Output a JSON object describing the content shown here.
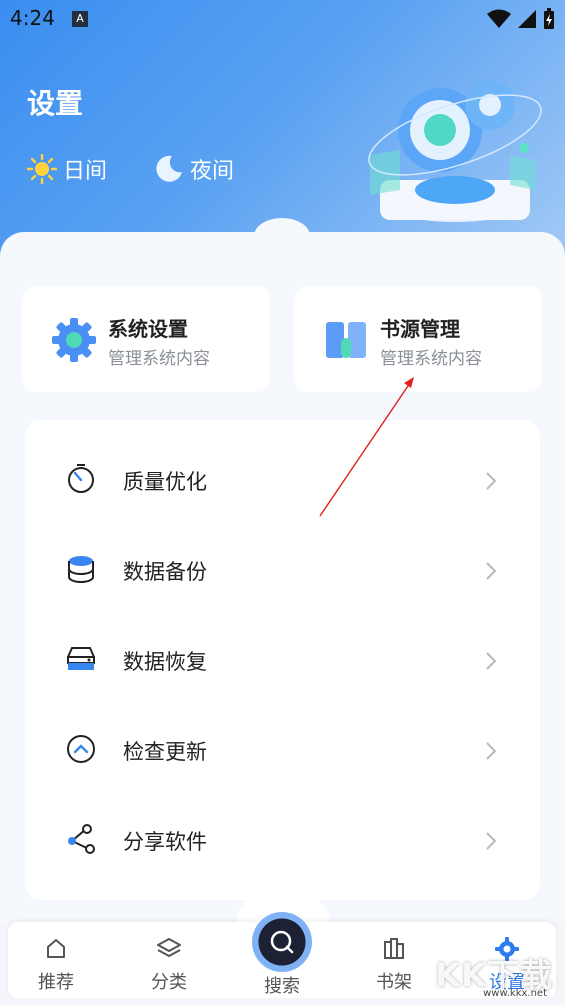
{
  "status_bar": {
    "time": "4:24",
    "app_badge": "A"
  },
  "header": {
    "title": "设置",
    "day_label": "日间",
    "night_label": "夜间"
  },
  "cards": [
    {
      "title": "系统设置",
      "subtitle": "管理系统内容"
    },
    {
      "title": "书源管理",
      "subtitle": "管理系统内容"
    }
  ],
  "list": [
    {
      "label": "质量优化",
      "icon": "timer-icon"
    },
    {
      "label": "数据备份",
      "icon": "database-icon"
    },
    {
      "label": "数据恢复",
      "icon": "server-icon"
    },
    {
      "label": "检查更新",
      "icon": "update-icon"
    },
    {
      "label": "分享软件",
      "icon": "share-icon"
    }
  ],
  "bottom_nav": [
    {
      "label": "推荐",
      "icon": "home-icon"
    },
    {
      "label": "分类",
      "icon": "layers-icon"
    },
    {
      "label": "搜索",
      "icon": "search-icon"
    },
    {
      "label": "书架",
      "icon": "bookshelf-icon"
    },
    {
      "label": "设置",
      "icon": "gear-icon",
      "active": true
    }
  ],
  "watermark": {
    "text": "KK下载",
    "url": "www.kkx.net"
  },
  "colors": {
    "accent": "#2f7bf0",
    "header_start": "#3a8ef0",
    "header_end": "#a9cdf6"
  }
}
